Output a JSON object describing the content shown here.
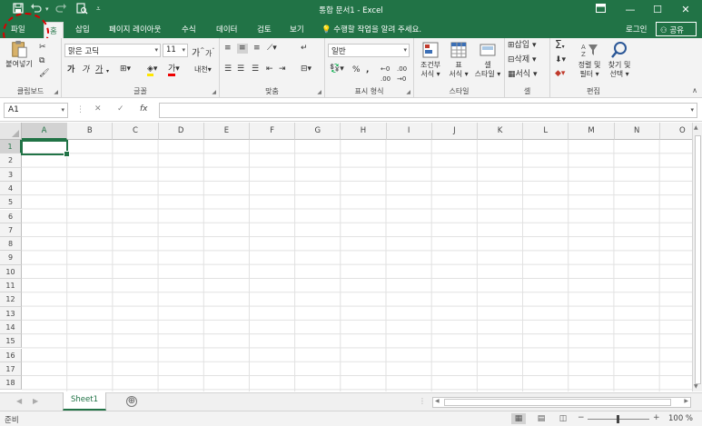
{
  "titlebar": {
    "title": "통합 문서1 - Excel",
    "quick_access": {
      "save_icon": "save-icon",
      "undo_icon": "undo-icon",
      "redo_icon": "redo-icon",
      "print_preview_icon": "print-preview-icon",
      "customize_icon": "chevron-down-icon"
    },
    "window_buttons": [
      "ribbon-display-options-icon",
      "minimize-icon",
      "restore-icon",
      "close-icon"
    ]
  },
  "tabs": {
    "file": "파일",
    "home": "홈",
    "insert": "삽입",
    "page_layout": "페이지 레이아웃",
    "formulas": "수식",
    "data": "데이터",
    "review": "검토",
    "view": "보기",
    "tell_me": "수행할 작업을 알려 주세요.",
    "login": "로그인",
    "share": "공유",
    "active": "home"
  },
  "ribbon": {
    "clipboard": {
      "label": "클립보드",
      "paste": "붙여넣기"
    },
    "font": {
      "label": "글꼴",
      "font_name": "맑은 고딕",
      "font_size": "11",
      "bold": "가",
      "italic": "가",
      "underline": "가",
      "grow": "가",
      "shrink": "가",
      "color_char": "가",
      "phonetic": "내천"
    },
    "alignment": {
      "label": "맞춤"
    },
    "number": {
      "label": "표시 형식",
      "format": "일반"
    },
    "styles": {
      "label": "스타일",
      "conditional": "조건부\n서식",
      "table": "표\n서식",
      "cell_styles": "셀\n스타일"
    },
    "cells": {
      "label": "셀",
      "insert": "삽입",
      "delete": "삭제",
      "format": "서식"
    },
    "editing": {
      "label": "편집",
      "sort_filter": "정렬 및\n필터",
      "find_select": "찾기 및\n선택"
    }
  },
  "formula_bar": {
    "name_box": "A1",
    "cancel": "✕",
    "enter": "✓",
    "fx": "fx",
    "value": ""
  },
  "grid": {
    "columns": [
      "A",
      "B",
      "C",
      "D",
      "E",
      "F",
      "G",
      "H",
      "I",
      "J",
      "K",
      "L",
      "M",
      "N",
      "O"
    ],
    "rows": [
      "1",
      "2",
      "3",
      "4",
      "5",
      "6",
      "7",
      "8",
      "9",
      "10",
      "11",
      "12",
      "13",
      "14",
      "15",
      "16",
      "17",
      "18"
    ],
    "active_cell": "A1"
  },
  "sheets": {
    "tabs": [
      "Sheet1"
    ],
    "active": "Sheet1",
    "add": "⊕"
  },
  "statusbar": {
    "status": "준비",
    "zoom": "100 %",
    "zoom_out": "−",
    "zoom_in": "+"
  },
  "colors": {
    "brand": "#217346",
    "callout": "#d90000"
  }
}
